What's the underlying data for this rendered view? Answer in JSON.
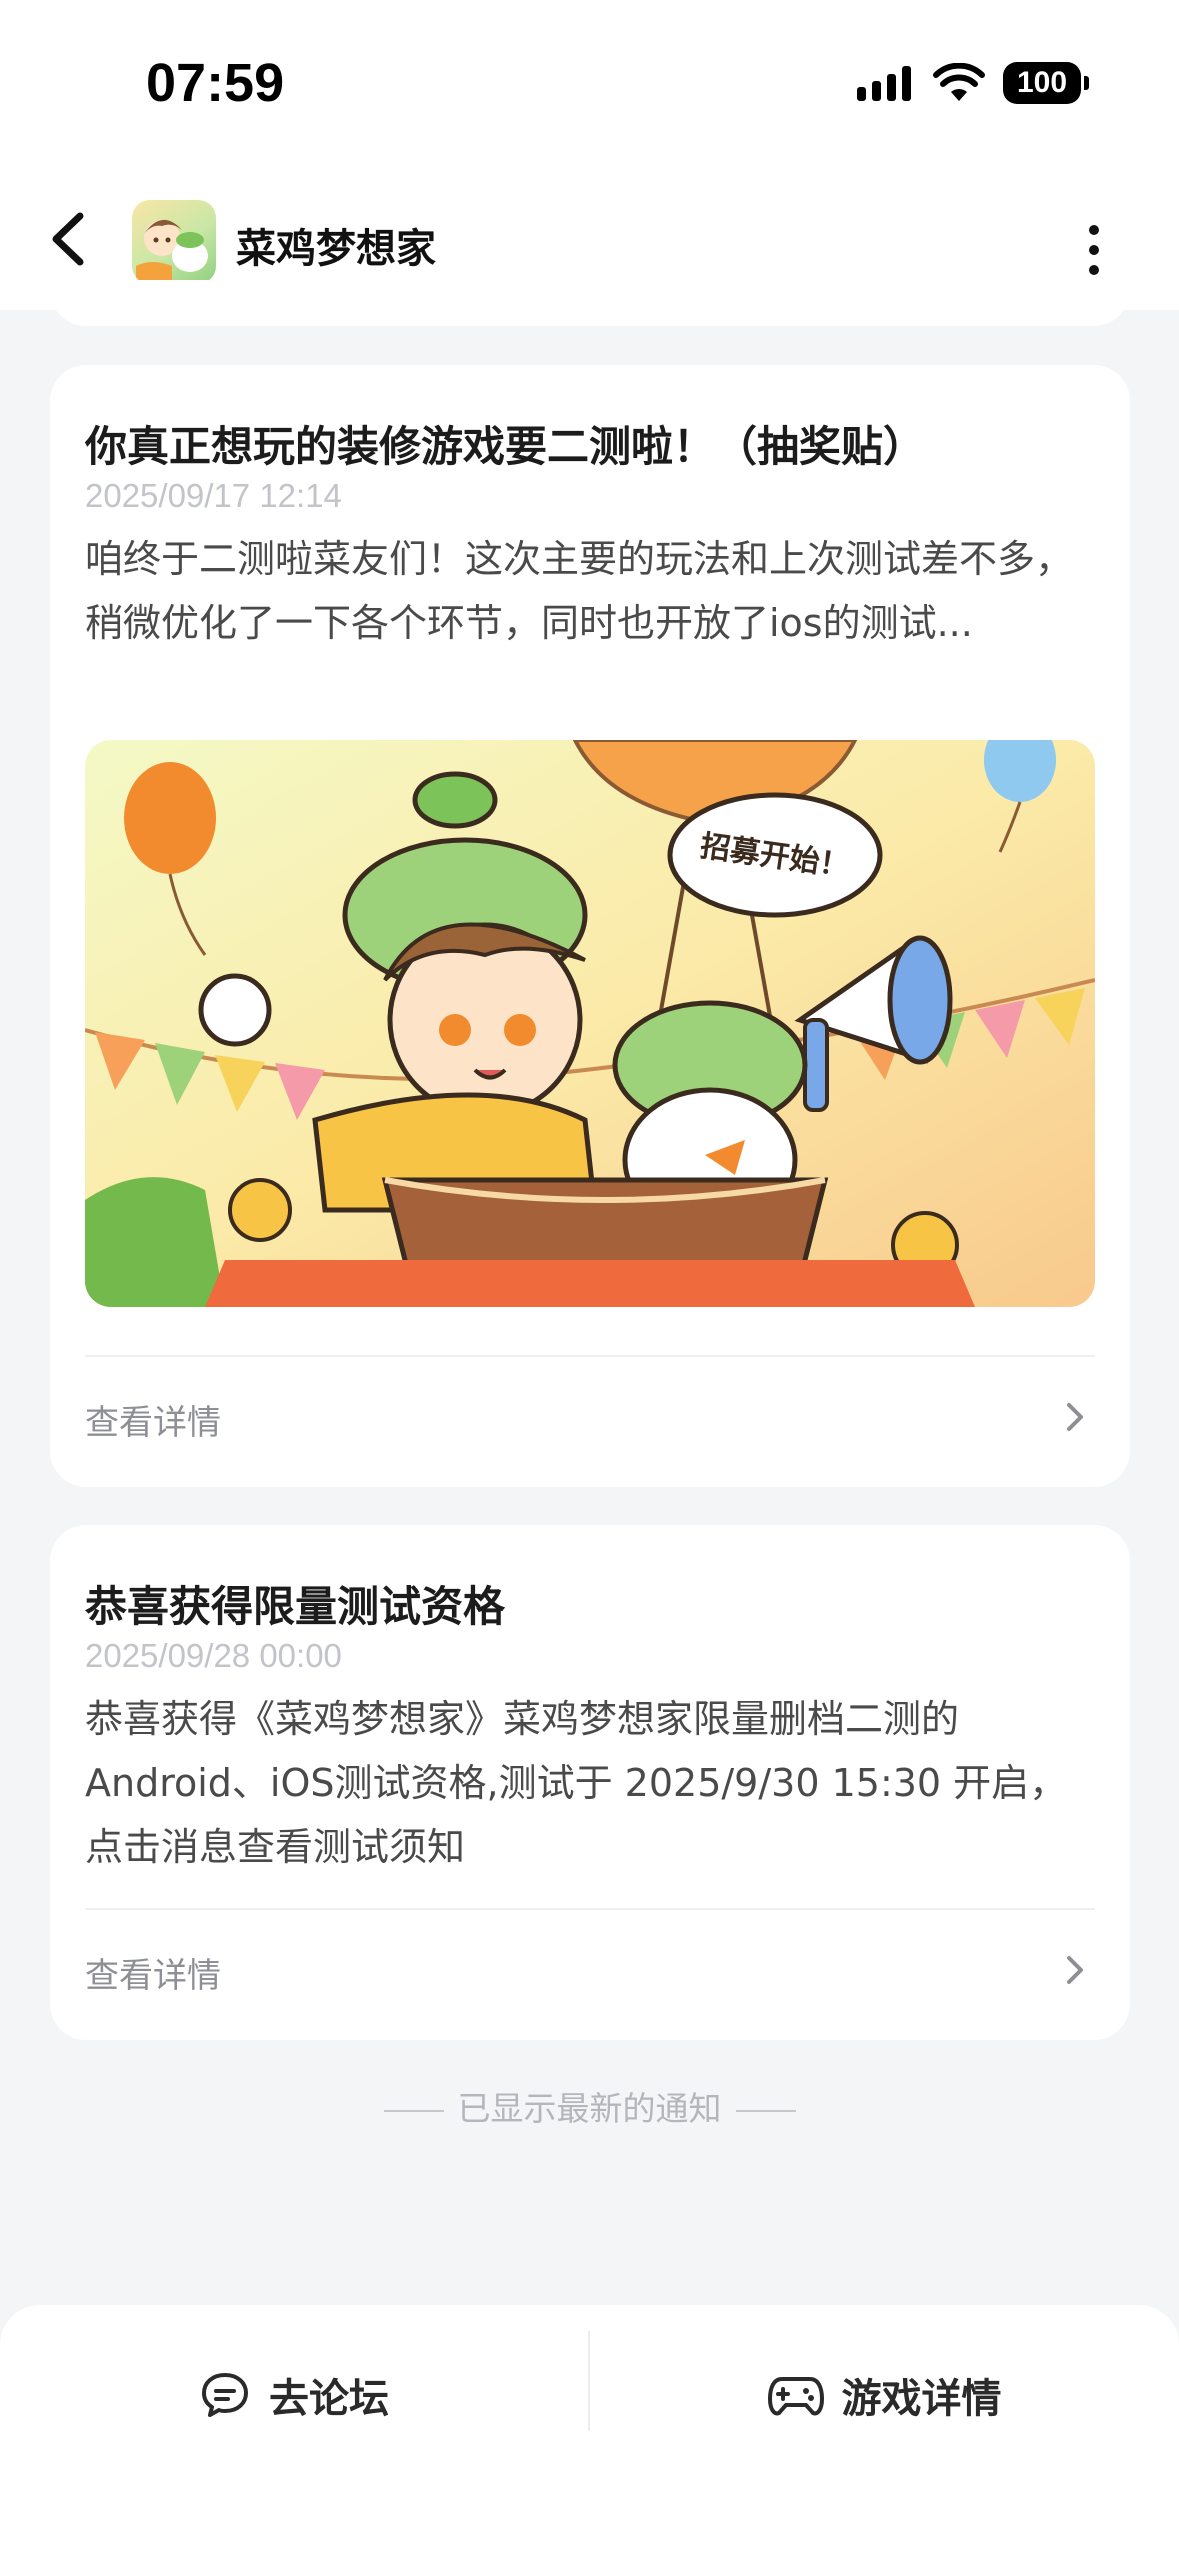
{
  "status_bar": {
    "time": "07:59",
    "battery": "100",
    "icons": [
      "signal-icon",
      "wifi-icon",
      "battery-icon"
    ]
  },
  "header": {
    "title": "菜鸡梦想家",
    "icons": [
      "back-arrow-icon",
      "app-icon",
      "more-vertical-icon"
    ]
  },
  "posts": [
    {
      "title": "你真正想玩的装修游戏要二测啦！（抽奖贴）",
      "date": "2025/09/17 12:14",
      "body": "咱终于二测啦菜友们！这次主要的玩法和上次测试差不多，稍微优化了一下各个环节，同时也开放了ios的测试...",
      "banner_text": "招募开始！",
      "detail_label": "查看详情"
    },
    {
      "title": "恭喜获得限量测试资格",
      "date": "2025/09/28 00:00",
      "body": "恭喜获得《菜鸡梦想家》菜鸡梦想家限量删档二测的 Android、iOS测试资格,测试于 2025/9/30 15:30 开启，点击消息查看测试须知",
      "detail_label": "查看详情"
    }
  ],
  "footer_note": "已显示最新的通知",
  "bottom_bar": {
    "forum_label": "去论坛",
    "game_detail_label": "游戏详情"
  },
  "colors": {
    "background": "#f4f5f7",
    "card": "#ffffff",
    "muted_text": "#8d8f94"
  }
}
